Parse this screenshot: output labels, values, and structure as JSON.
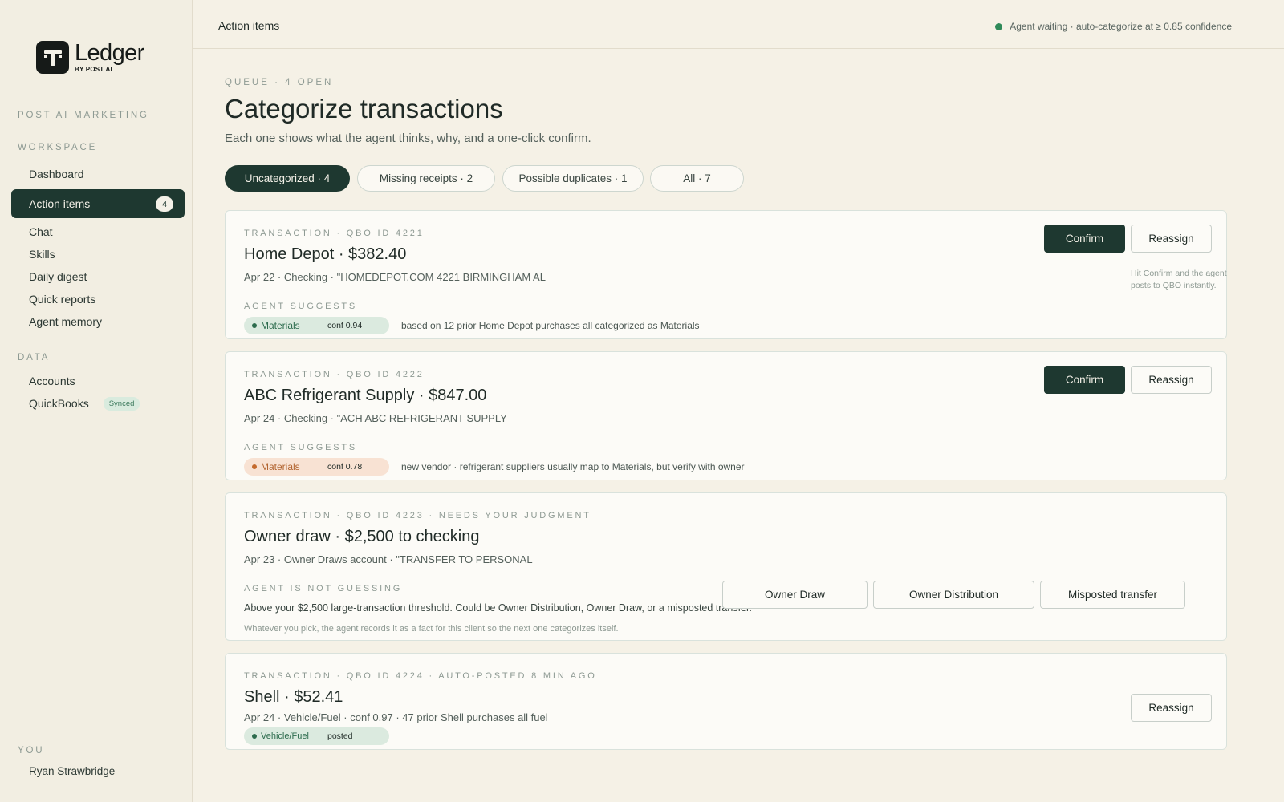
{
  "app": {
    "logo_word": "Ledger",
    "logo_sub": "BY POST AI"
  },
  "sidebar": {
    "org": "POST AI MARKETING",
    "workspace_label": "WORKSPACE",
    "workspace_items": [
      {
        "label": "Dashboard"
      },
      {
        "label": "Action items",
        "badge": "4",
        "active": true
      },
      {
        "label": "Chat"
      },
      {
        "label": "Skills"
      },
      {
        "label": "Daily digest"
      },
      {
        "label": "Quick reports"
      },
      {
        "label": "Agent memory"
      }
    ],
    "data_label": "DATA",
    "data_items": [
      {
        "label": "Accounts"
      },
      {
        "label": "QuickBooks",
        "badge": "Synced"
      }
    ],
    "you_label": "YOU",
    "user_name": "Ryan Strawbridge"
  },
  "header": {
    "title": "Action items",
    "agent_status": "Agent waiting · auto-categorize at ≥ 0.85 confidence",
    "status_color": "#2f8a59"
  },
  "main": {
    "eyebrow": "QUEUE · 4 OPEN",
    "title": "Categorize transactions",
    "subtitle": "Each one shows what the agent thinks, why, and a one-click confirm.",
    "filters": [
      {
        "label": "Uncategorized · 4",
        "active": true
      },
      {
        "label": "Missing receipts · 2"
      },
      {
        "label": "Possible duplicates · 1"
      },
      {
        "label": "All · 7"
      }
    ]
  },
  "cards": [
    {
      "eyebrow": "TRANSACTION · QBO ID 4221",
      "title": "Home Depot · $382.40",
      "meta": "Apr 22 · Checking · \"HOMEDEPOT.COM 4221 BIRMINGHAM AL",
      "suggest_label": "AGENT SUGGESTS",
      "category": "Materials",
      "confidence": "conf 0.94",
      "reason": "based on 12 prior Home Depot purchases all categorized as Materials",
      "confirm_label": "Confirm",
      "reassign_label": "Reassign",
      "hint": "Hit Confirm and the agent posts to QBO instantly."
    },
    {
      "eyebrow": "TRANSACTION · QBO ID 4222",
      "title": "ABC Refrigerant Supply · $847.00",
      "meta": "Apr 24 · Checking · \"ACH ABC REFRIGERANT SUPPLY",
      "suggest_label": "AGENT SUGGESTS",
      "category": "Materials",
      "confidence": "conf 0.78",
      "reason": "new vendor · refrigerant suppliers usually map to Materials, but verify with owner",
      "confirm_label": "Confirm",
      "reassign_label": "Reassign"
    },
    {
      "eyebrow": "TRANSACTION · QBO ID 4223 · NEEDS YOUR JUDGMENT",
      "title": "Owner draw · $2,500 to checking",
      "meta": "Apr 23 · Owner Draws account · \"TRANSFER TO PERSONAL",
      "suggest_label": "AGENT IS NOT GUESSING",
      "body": "Above your $2,500 large-transaction threshold. Could be Owner Distribution, Owner Draw, or a misposted transfer.",
      "fine": "Whatever you pick, the agent records it as a fact for this client so the next one categorizes itself.",
      "options": [
        "Owner Draw",
        "Owner Distribution",
        "Misposted transfer"
      ]
    },
    {
      "eyebrow": "TRANSACTION · QBO ID 4224 · AUTO-POSTED 8 MIN AGO",
      "title": "Shell · $52.41",
      "meta": "Apr 24 · Vehicle/Fuel · conf 0.97 · 47 prior Shell purchases all fuel",
      "category": "Vehicle/Fuel",
      "status": "posted",
      "reassign_label": "Reassign"
    }
  ]
}
